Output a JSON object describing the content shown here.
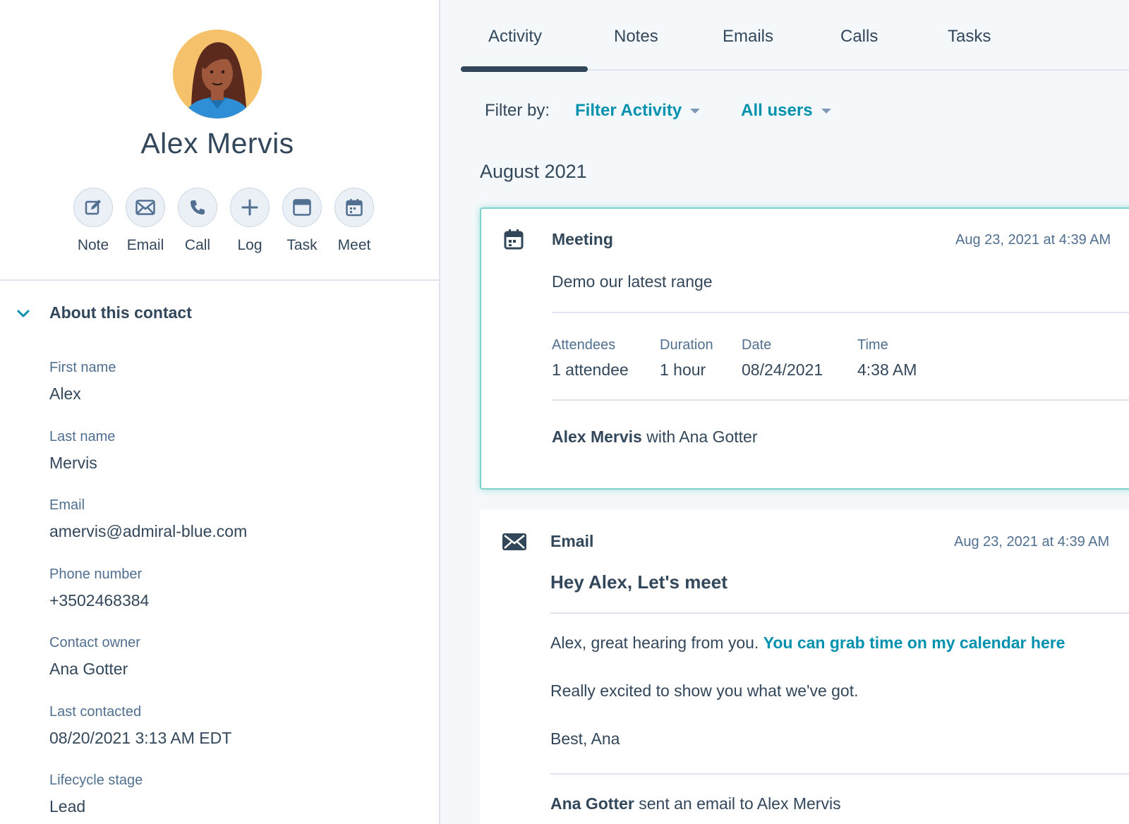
{
  "contact": {
    "name": "Alex Mervis"
  },
  "actions": [
    {
      "label": "Note",
      "icon": "note-icon"
    },
    {
      "label": "Email",
      "icon": "email-icon"
    },
    {
      "label": "Call",
      "icon": "call-icon"
    },
    {
      "label": "Log",
      "icon": "plus-icon"
    },
    {
      "label": "Task",
      "icon": "task-icon"
    },
    {
      "label": "Meet",
      "icon": "calendar-icon"
    }
  ],
  "about": {
    "title": "About this contact",
    "properties": [
      {
        "label": "First name",
        "value": "Alex"
      },
      {
        "label": "Last name",
        "value": "Mervis"
      },
      {
        "label": "Email",
        "value": "amervis@admiral-blue.com"
      },
      {
        "label": "Phone number",
        "value": "+3502468384"
      },
      {
        "label": "Contact owner",
        "value": "Ana Gotter"
      },
      {
        "label": "Last contacted",
        "value": "08/20/2021 3:13 AM EDT"
      },
      {
        "label": "Lifecycle stage",
        "value": "Lead"
      }
    ]
  },
  "tabs": [
    {
      "label": "Activity",
      "active": true
    },
    {
      "label": "Notes"
    },
    {
      "label": "Emails"
    },
    {
      "label": "Calls"
    },
    {
      "label": "Tasks"
    }
  ],
  "filter": {
    "label": "Filter by:",
    "activity": "Filter Activity",
    "users": "All users"
  },
  "timeline": {
    "month": "August 2021",
    "meeting": {
      "type": "Meeting",
      "timestamp": "Aug 23, 2021 at 4:39 AM",
      "description": "Demo our latest range",
      "meta": [
        {
          "label": "Attendees",
          "value": "1 attendee"
        },
        {
          "label": "Duration",
          "value": "1 hour"
        },
        {
          "label": "Date",
          "value": "08/24/2021"
        },
        {
          "label": "Time",
          "value": "4:38 AM"
        }
      ],
      "participant_bold": "Alex Mervis",
      "participant_rest": " with Ana Gotter"
    },
    "email": {
      "type": "Email",
      "timestamp": "Aug 23, 2021 at 4:39 AM",
      "subject": "Hey Alex, Let's meet",
      "body_line1": "Alex, great hearing from you. ",
      "body_link": "You can grab time on my calendar here",
      "body_line2": "Really excited to show you what we've got.",
      "body_line3": "Best, Ana",
      "footer_bold": "Ana Gotter",
      "footer_rest": " sent an email to Alex Mervis"
    }
  },
  "colors": {
    "text": "#33475b",
    "accent_link": "#0091ae",
    "border": "#dfe3eb",
    "highlight": "#7fd1cc"
  }
}
